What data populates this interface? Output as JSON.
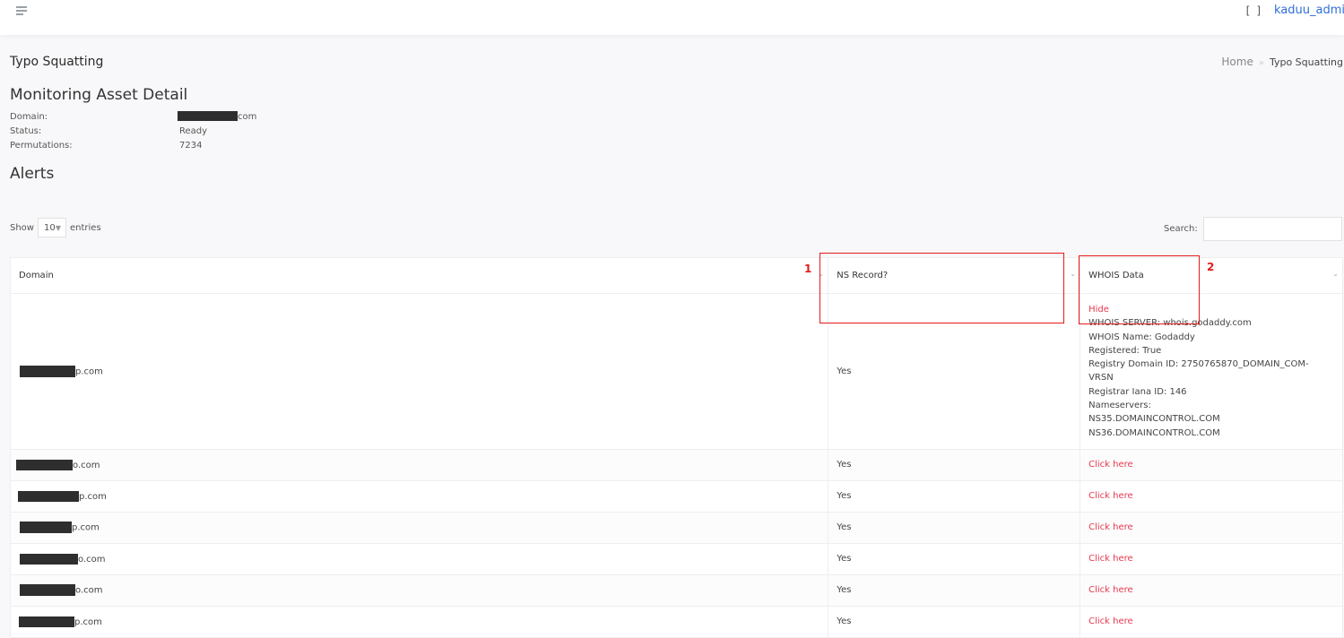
{
  "header": {
    "menu_icon": "hamburger-menu-icon",
    "fullscreen_glyph": "[ ]",
    "fullscreen_icon": "fullscreen-icon",
    "username": "kaduu_admi",
    "accent_color": "#2f6fd8"
  },
  "page": {
    "title": "Typo Squatting",
    "breadcrumb": {
      "home": "Home",
      "separator": "»",
      "current": "Typo Squatting"
    }
  },
  "asset": {
    "heading": "Monitoring Asset Detail",
    "domain_label": "Domain:",
    "domain_suffix": "com",
    "status_label": "Status:",
    "status_value": "Ready",
    "permutations_label": "Permutations:",
    "permutations_value": "7234"
  },
  "alerts": {
    "heading": "Alerts",
    "show_label": "Show",
    "entries_value": "10",
    "entries_label": "entries",
    "search_label": "Search:",
    "search_value": "",
    "columns": [
      "Domain",
      "NS Record?",
      "WHOIS Data"
    ],
    "expanded_row": {
      "domain_suffix": "p.com",
      "ns_record": "Yes",
      "whois_toggle": "Hide",
      "whois_lines": [
        "WHOIS SERVER: whois.godaddy.com",
        "WHOIS Name: Godaddy",
        "Registered: True",
        "Registry Domain ID: 2750765870_DOMAIN_COM-",
        "VRSN",
        "Registrar Iana ID: 146",
        "Nameservers:",
        "NS35.DOMAINCONTROL.COM",
        "NS36.DOMAINCONTROL.COM"
      ]
    },
    "rows": [
      {
        "domain_suffix": "o.com",
        "ns_record": "Yes",
        "whois_link": "Click here"
      },
      {
        "domain_suffix": "p.com",
        "ns_record": "Yes",
        "whois_link": "Click here"
      },
      {
        "domain_suffix": "p.com",
        "ns_record": "Yes",
        "whois_link": "Click here"
      },
      {
        "domain_suffix": "o.com",
        "ns_record": "Yes",
        "whois_link": "Click here"
      },
      {
        "domain_suffix": "o.com",
        "ns_record": "Yes",
        "whois_link": "Click here"
      },
      {
        "domain_suffix": "p.com",
        "ns_record": "Yes",
        "whois_link": "Click here"
      }
    ],
    "link_color": "#e8384f"
  },
  "annotations": {
    "label_1": "1",
    "label_2": "2",
    "color": "#e31b1b"
  }
}
